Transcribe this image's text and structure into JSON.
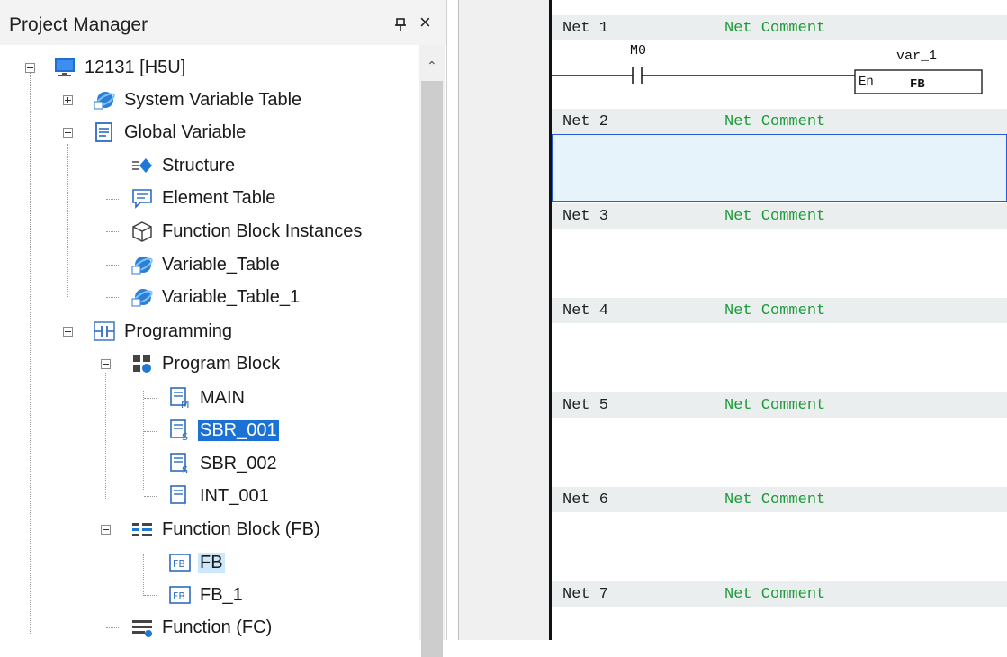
{
  "project_manager": {
    "title": "Project Manager",
    "pin_icon": "pin-icon",
    "close_icon": "×",
    "tree": {
      "root": "12131 [H5U]",
      "system_variable_table": "System Variable Table",
      "global_variable": "Global Variable",
      "structure": "Structure",
      "element_table": "Element Table",
      "function_block_instances": "Function Block Instances",
      "variable_table": "Variable_Table",
      "variable_table_1": "Variable_Table_1",
      "programming": "Programming",
      "program_block": "Program Block",
      "main": "MAIN",
      "sbr_001": "SBR_001",
      "sbr_002": "SBR_002",
      "int_001": "INT_001",
      "function_block_fb": "Function Block (FB)",
      "fb": "FB",
      "fb_1": "FB_1",
      "function_fc": "Function (FC)"
    },
    "selected_item": "SBR_001",
    "hovered_item": "FB"
  },
  "editor": {
    "nets": [
      {
        "label": "Net 1",
        "comment": "Net Comment"
      },
      {
        "label": "Net 2",
        "comment": "Net Comment"
      },
      {
        "label": "Net 3",
        "comment": "Net Comment"
      },
      {
        "label": "Net 4",
        "comment": "Net Comment"
      },
      {
        "label": "Net 5",
        "comment": "Net Comment"
      },
      {
        "label": "Net 6",
        "comment": "Net Comment"
      },
      {
        "label": "Net 7",
        "comment": "Net Comment"
      }
    ],
    "net1": {
      "contact_label": "M0",
      "instance_name": "var_1",
      "block_input": "En",
      "block_name": "FB"
    },
    "active_net": "Net 2"
  },
  "colors": {
    "selection": "#1c72d4",
    "hover": "#cde8fb",
    "comment_green": "#1f9a3a",
    "active_net_border": "#2a5bd7",
    "active_net_fill": "#e6f3fb"
  }
}
